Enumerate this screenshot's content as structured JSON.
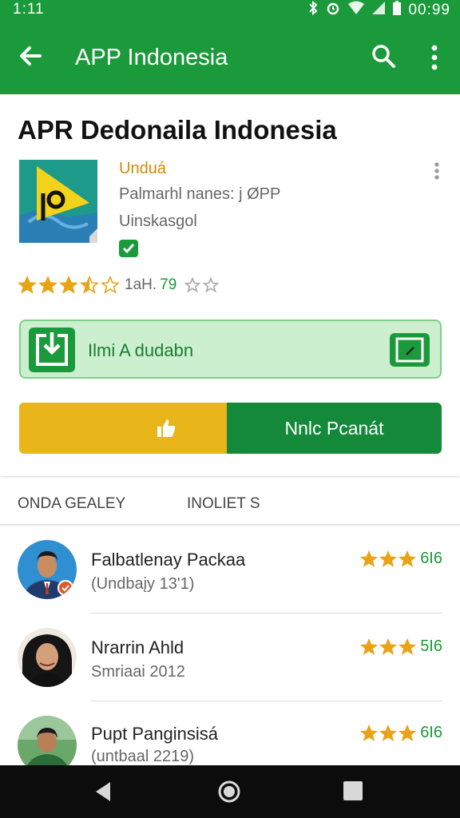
{
  "status_bar": {
    "time": "1:11",
    "clock": "00:99"
  },
  "app_bar": {
    "title": "APP Indonesia"
  },
  "app": {
    "name": "APR Dedonaila Indonesia",
    "publisher": "Unduá",
    "meta_line_1": "Palmarhl nanes: j ØPP",
    "meta_line_2": "Uinskasgol",
    "rating_text": "1aH.",
    "rating_number": "79",
    "stars": 3.5
  },
  "install": {
    "label": "Ilmi A dudabn"
  },
  "actions": {
    "open_label": "Nnlc Pcanát"
  },
  "tabs": [
    {
      "label": "ONDA GEALEY"
    },
    {
      "label": "INOLIET S"
    }
  ],
  "reviews": [
    {
      "name": "Falbatlenay Packaa",
      "subtitle": "(Undbaįy 13'1)",
      "rating_num": "6I6",
      "stars": 3
    },
    {
      "name": "Nrarrin Ahld",
      "subtitle": "Smriaai 2012",
      "rating_num": "5I6",
      "stars": 3
    },
    {
      "name": "Pupt Panginsisá",
      "subtitle": "(untbaal 2219)",
      "rating_num": "6I6",
      "stars": 3
    }
  ],
  "colors": {
    "brand_green": "#1a9a3a",
    "star_gold": "#e8a415",
    "like_yellow": "#e8b51a"
  },
  "icons": [
    "back-arrow-icon",
    "search-icon",
    "more-vert-icon",
    "download-icon",
    "thumbs-up-icon",
    "star-icon",
    "nav-back-icon",
    "nav-home-icon",
    "nav-recents-icon"
  ]
}
